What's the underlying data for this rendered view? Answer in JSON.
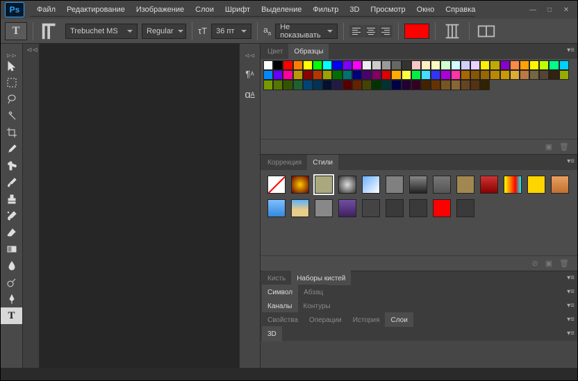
{
  "app": {
    "logo": "Ps"
  },
  "menu": [
    "Файл",
    "Редактирование",
    "Изображение",
    "Слои",
    "Шрифт",
    "Выделение",
    "Фильтр",
    "3D",
    "Просмотр",
    "Окно",
    "Справка"
  ],
  "options": {
    "font_family": "Trebuchet MS",
    "font_style": "Regular",
    "font_size": "36 пт",
    "antialias": "Не показывать",
    "fill_color": "#ff0000"
  },
  "panels": {
    "color": {
      "tabs": [
        "Цвет",
        "Образцы"
      ],
      "active": 1
    },
    "correction": {
      "tabs": [
        "Коррекция",
        "Стили"
      ],
      "active": 1
    },
    "brush": {
      "tabs": [
        "Кисть",
        "Наборы кистей"
      ],
      "active": 1
    },
    "char": {
      "tabs": [
        "Символ",
        "Абзац"
      ],
      "active": 0
    },
    "channels": {
      "tabs": [
        "Каналы",
        "Контуры"
      ],
      "active": 0
    },
    "props": {
      "tabs": [
        "Свойства",
        "Операции",
        "История",
        "Слои"
      ],
      "active": 3
    },
    "threeD": {
      "tabs": [
        "3D"
      ],
      "active": 0
    }
  },
  "swatches_row1": [
    "#ffffff",
    "#000000",
    "#ff0000",
    "#ff7f00",
    "#ffff00",
    "#00ff00",
    "#00ffff",
    "#0000ff",
    "#7f00ff",
    "#ff00ff",
    "#eeeeee",
    "#cccccc",
    "#999999",
    "#666666",
    "#333333",
    "#f7c5c5",
    "#fff0c0",
    "#fffac0",
    "#d0ffd0",
    "#d0ffff",
    "#d0d0ff",
    "#e8d0ff",
    "#ffef00",
    "#c0aa00",
    "#8800cc",
    "#ff8844",
    "#ffa200",
    "#fff600",
    "#c0ff00",
    "#00ff88",
    "#00d0ff",
    "#0088ff",
    "#6600ff",
    "#ff0099",
    "#bb9900"
  ],
  "swatches_row2": [
    "#8c0000",
    "#b83500",
    "#a0a000",
    "#007000",
    "#007070",
    "#000080",
    "#4a0070",
    "#800066",
    "#dd0000",
    "#ffaa00",
    "#ffff44",
    "#00ee44",
    "#44ddff",
    "#3333ff",
    "#aa00dd",
    "#ff33aa",
    "#aa6600",
    "#885500",
    "#996600",
    "#bb8800",
    "#cc9900",
    "#ddaa33",
    "#bb7744",
    "#776644",
    "#554433",
    "#332211",
    "#99aa00",
    "#779900",
    "#557700",
    "#335500",
    "#206030",
    "#004477",
    "#003355",
    "#001133",
    "#221a44"
  ],
  "swatches_row3": [
    "#550000",
    "#662200",
    "#444400",
    "#003300",
    "#003333",
    "#000044",
    "#220033",
    "#330022",
    "#442200",
    "#663300",
    "#775522",
    "#886633",
    "#664422",
    "#553311",
    "#332200"
  ],
  "styles_row1": [
    {
      "bg": "none"
    },
    {
      "bg": "radial-gradient(circle,#ffcc00,#660000)"
    },
    {
      "bg": "#aaa87f",
      "sel": true
    },
    {
      "bg": "radial-gradient(circle,#ddd,#333)"
    },
    {
      "bg": "linear-gradient(135deg,#6ab0ff,#fff)"
    },
    {
      "bg": "#808080"
    },
    {
      "bg": "linear-gradient(#888,#222)"
    },
    {
      "bg": "linear-gradient(#777,#555)"
    },
    {
      "bg": "#a28850"
    },
    {
      "bg": "linear-gradient(#cc3333,#880000)"
    },
    {
      "bg": "linear-gradient(90deg,#ff0,#f80,#f00,#0ff)"
    },
    {
      "bg": "#ffd500"
    },
    {
      "bg": "linear-gradient(#e8a060,#c07030)"
    },
    {
      "bg": "linear-gradient(#7ec0ff,#3388dd)"
    }
  ],
  "styles_row2": [
    {
      "bg": "linear-gradient(#5ab0ff,#e8cc88 60%)"
    },
    {
      "bg": "#888"
    },
    {
      "bg": "linear-gradient(#7050a0,#402060)"
    },
    {
      "bg": "#444"
    },
    {
      "bg": "#3a3a3a"
    },
    {
      "bg": "#3a3a3a"
    },
    {
      "bg": "#ff0000"
    },
    {
      "bg": "#3a3a3a"
    }
  ]
}
